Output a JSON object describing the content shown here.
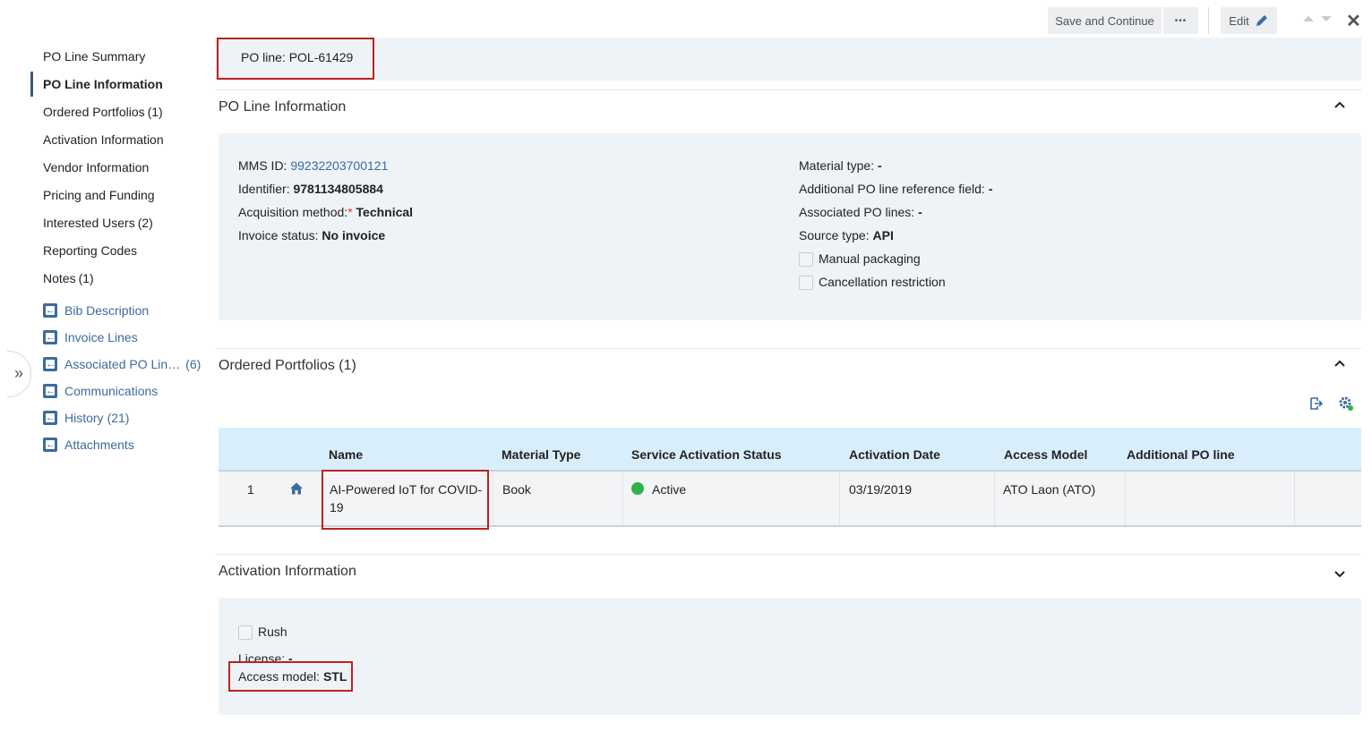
{
  "toolbar": {
    "save_continue": "Save and Continue",
    "more": "•••",
    "edit": "Edit",
    "close": "✕"
  },
  "nav": {
    "items": [
      {
        "label": "PO Line Summary"
      },
      {
        "label": "PO Line Information"
      },
      {
        "label": "Ordered Portfolios",
        "count": "(1)"
      },
      {
        "label": "Activation Information"
      },
      {
        "label": "Vendor Information"
      },
      {
        "label": "Pricing and Funding"
      },
      {
        "label": "Interested Users",
        "count": "(2)"
      },
      {
        "label": "Reporting Codes"
      },
      {
        "label": "Notes",
        "count": "(1)"
      }
    ],
    "links": [
      {
        "label": "Bib Description"
      },
      {
        "label": "Invoice Lines"
      },
      {
        "label": "Associated PO Lin…",
        "count": "(6)"
      },
      {
        "label": "Communications"
      },
      {
        "label": "History",
        "count": "(21)"
      },
      {
        "label": "Attachments"
      }
    ],
    "expand": "»"
  },
  "header": {
    "po_line": "PO line: POL-61429"
  },
  "po_line_info": {
    "title": "PO Line Information",
    "mms_label": "MMS ID:",
    "mms_value": "99232203700121",
    "identifier_label": "Identifier:",
    "identifier_value": "9781134805884",
    "acq_label": "Acquisition method:",
    "acq_req": "*",
    "acq_value": "Technical",
    "invoice_label": "Invoice status:",
    "invoice_value": "No invoice",
    "material_label": "Material type:",
    "material_value": "-",
    "addref_label": "Additional PO line reference field:",
    "addref_value": "-",
    "assoc_label": "Associated PO lines:",
    "assoc_value": "-",
    "source_label": "Source type:",
    "source_value": "API",
    "manual_packaging": "Manual packaging",
    "cancellation": "Cancellation restriction"
  },
  "ordered_portfolios": {
    "title": "Ordered Portfolios (1)",
    "columns": [
      "Name",
      "Material Type",
      "Service Activation Status",
      "Activation Date",
      "Access Model",
      "Additional PO line"
    ],
    "rows": [
      {
        "num": "1",
        "name": "AI-Powered IoT for COVID-19",
        "material": "Book",
        "status": "Active",
        "date": "03/19/2019",
        "access": "ATO Laon (ATO)",
        "additional": ""
      }
    ],
    "status_color": "#2eb24a"
  },
  "activation": {
    "title": "Activation Information",
    "rush": "Rush",
    "license_label": "License:",
    "license_value": "-",
    "access_label": "Access model:",
    "access_value": "STL"
  }
}
